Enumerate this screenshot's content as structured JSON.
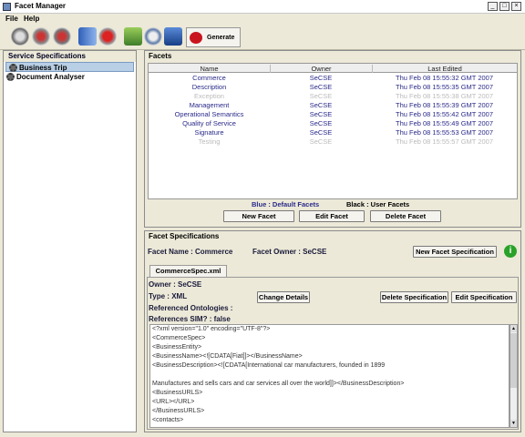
{
  "window": {
    "title": "Facet Manager"
  },
  "menu": [
    "File",
    "Help"
  ],
  "toolbar": {
    "icons": [
      "gear-icon",
      "tool-icon",
      "tool2-icon",
      "arrow-right-icon",
      "arrow-left-icon",
      "print-icon",
      "search-icon",
      "book-icon"
    ],
    "generate_label": "Generate"
  },
  "left": {
    "header": "Service Specifications",
    "items": [
      "Business Trip",
      "Document Analyser"
    ]
  },
  "facets": {
    "header": "Facets",
    "columns": [
      "Name",
      "Owner",
      "Last Edited"
    ],
    "rows": [
      {
        "name": "Commerce",
        "owner": "SeCSE",
        "edited": "Thu Feb 08 15:55:32 GMT 2007",
        "style": "def"
      },
      {
        "name": "Description",
        "owner": "SeCSE",
        "edited": "Thu Feb 08 15:55:35 GMT 2007",
        "style": "def"
      },
      {
        "name": "Exception",
        "owner": "SeCSE",
        "edited": "Thu Feb 08 15:55:38 GMT 2007",
        "style": "faded"
      },
      {
        "name": "Management",
        "owner": "SeCSE",
        "edited": "Thu Feb 08 15:55:39 GMT 2007",
        "style": "def"
      },
      {
        "name": "Operational Semantics",
        "owner": "SeCSE",
        "edited": "Thu Feb 08 15:55:42 GMT 2007",
        "style": "def"
      },
      {
        "name": "Quality of Service",
        "owner": "SeCSE",
        "edited": "Thu Feb 08 15:55:49 GMT 2007",
        "style": "def"
      },
      {
        "name": "Signature",
        "owner": "SeCSE",
        "edited": "Thu Feb 08 15:55:53 GMT 2007",
        "style": "def"
      },
      {
        "name": "Testing",
        "owner": "SeCSE",
        "edited": "Thu Feb 08 15:55:57 GMT 2007",
        "style": "faded"
      }
    ],
    "legend_default": "Blue : Default Facets",
    "legend_user": "Black : User Facets",
    "new_btn": "New Facet",
    "edit_btn": "Edit Facet",
    "delete_btn": "Delete Facet"
  },
  "specs": {
    "header": "Facet Specifications",
    "facet_name": "Facet Name : Commerce",
    "facet_owner": "Facet Owner : SeCSE",
    "new_spec_btn": "New Facet Specification",
    "tab": "CommerceSpec.xml",
    "owner": "Owner : SeCSE",
    "type": "Type : XML",
    "ontologies": "Referenced Ontologies :",
    "sim": "References SIM? : false",
    "change_btn": "Change Details",
    "delete_spec_btn": "Delete Specification",
    "edit_spec_btn": "Edit Specification",
    "xml_lines": [
      "<?xml version=\"1.0\" encoding=\"UTF-8\"?>",
      "<CommerceSpec>",
      "<BusinessEntity>",
      "<BusinessName><![CDATA[Fiat]]></BusinessName>",
      "<BusinessDescription><![CDATA[International car manufacturers, founded in 1899",
      "",
      "Manufactures and sells cars and car services all over the world]]></BusinessDescription>",
      "<BusinessURLS>",
      "<URL></URL>",
      "</BusinessURLS>",
      "<contacts>"
    ]
  },
  "colors": {
    "default_facet": "#2a2a8a",
    "selected": "#b8cfe5",
    "generate": "#c9141e",
    "help": "#2aa22a"
  }
}
